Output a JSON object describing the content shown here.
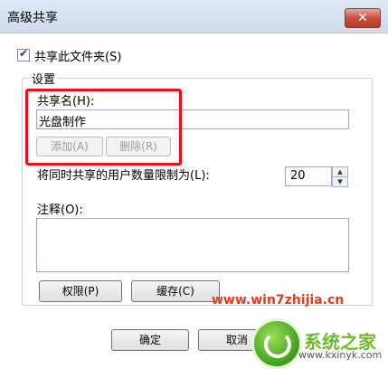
{
  "window": {
    "title": "高级共享"
  },
  "share_checkbox": {
    "label": "共享此文件夹(S)",
    "checked": true
  },
  "settings": {
    "group_title": "设置",
    "share_name_label": "共享名(H):",
    "share_name_value": "光盘制作",
    "add_button": "添加(A)",
    "delete_button": "删除(R)",
    "limit_label": "将同时共享的用户数量限制为(L):",
    "limit_value": "20",
    "comment_label": "注释(O):",
    "comment_value": "",
    "permissions_button": "权限(P)",
    "caching_button": "缓存(C)"
  },
  "footer": {
    "ok_button": "确定",
    "cancel_button": "取消"
  },
  "watermark": {
    "site": "www.win7zhijia.cn",
    "brand": "系统之家",
    "url": "www.kxinyk.com"
  }
}
